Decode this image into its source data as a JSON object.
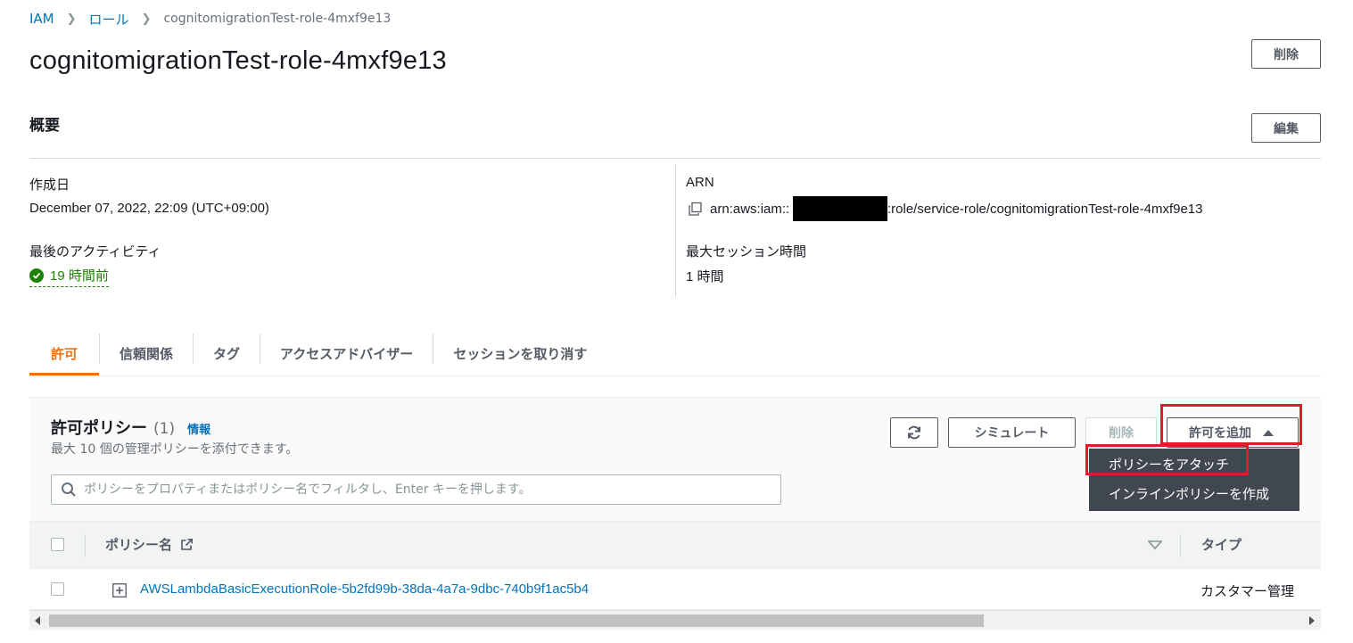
{
  "breadcrumb": {
    "root": "IAM",
    "section": "ロール",
    "current": "cognitomigrationTest-role-4mxf9e13"
  },
  "page": {
    "title": "cognitomigrationTest-role-4mxf9e13",
    "delete_label": "削除"
  },
  "summary": {
    "heading": "概要",
    "edit_label": "編集",
    "created_label": "作成日",
    "created_value": "December 07, 2022, 22:09 (UTC+09:00)",
    "last_activity_label": "最後のアクティビティ",
    "last_activity_value": "19 時間前",
    "arn_label": "ARN",
    "arn_prefix": "arn:aws:iam::",
    "arn_suffix": ":role/service-role/cognitomigrationTest-role-4mxf9e13",
    "max_session_label": "最大セッション時間",
    "max_session_value": "1 時間"
  },
  "tabs": [
    {
      "label": "許可"
    },
    {
      "label": "信頼関係"
    },
    {
      "label": "タグ"
    },
    {
      "label": "アクセスアドバイザー"
    },
    {
      "label": "セッションを取り消す"
    }
  ],
  "policies": {
    "title": "許可ポリシー",
    "count": "(1)",
    "info_label": "情報",
    "description": "最大 10 個の管理ポリシーを添付できます。",
    "simulate_label": "シミュレート",
    "delete_label": "削除",
    "add_label": "許可を追加",
    "search_placeholder": "ポリシーをプロパティまたはポリシー名でフィルタし、Enter キーを押します。",
    "menu": [
      {
        "label": "ポリシーをアタッチ"
      },
      {
        "label": "インラインポリシーを作成"
      }
    ],
    "columns": {
      "name": "ポリシー名",
      "type": "タイプ"
    },
    "rows": [
      {
        "name": "AWSLambdaBasicExecutionRole-5b2fd99b-38da-4a7a-9dbc-740b9f1ac5b4",
        "type": "カスタマー管理"
      }
    ]
  },
  "colors": {
    "link": "#0073bb",
    "accent": "#ec7211",
    "success": "#1d8102",
    "highlight": "#d91f2c"
  }
}
